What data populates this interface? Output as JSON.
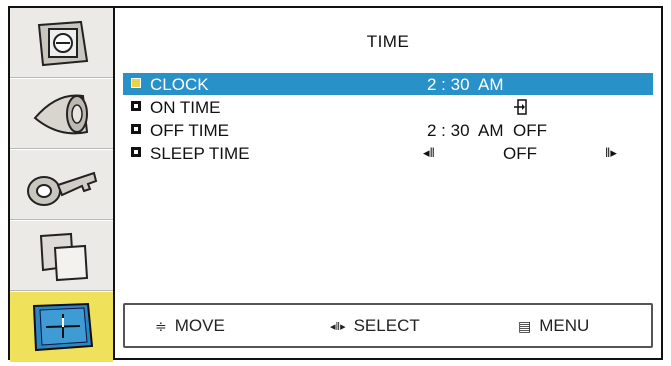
{
  "title": "TIME",
  "sidebar": {
    "items": [
      {
        "icon": "picture-frame-icon",
        "selected": false
      },
      {
        "icon": "speaker-cone-icon",
        "selected": false
      },
      {
        "icon": "key-icon",
        "selected": false
      },
      {
        "icon": "window-pip-icon",
        "selected": false
      },
      {
        "icon": "clock-icon",
        "selected": true
      }
    ]
  },
  "menu": {
    "rows": [
      {
        "label": "CLOCK",
        "value": "2 : 30  AM",
        "selected": true
      },
      {
        "label": "ON TIME",
        "value_icon": "enter-icon",
        "selected": false
      },
      {
        "label": "OFF TIME",
        "value": "2 : 30  AM  OFF",
        "selected": false
      },
      {
        "label": "SLEEP TIME",
        "value": "OFF",
        "left_arrow": "◂‖",
        "right_arrow": "‖▸",
        "selected": false
      }
    ]
  },
  "footer": {
    "move": {
      "icon": "≑",
      "label": "MOVE"
    },
    "select": {
      "icon": "◂‖▸",
      "label": "SELECT"
    },
    "menu": {
      "icon": "▤",
      "label": "MENU"
    }
  },
  "colors": {
    "highlight": "#2891c8",
    "selected_tab": "#efe25a",
    "sidebar_bg": "#eceae6"
  }
}
